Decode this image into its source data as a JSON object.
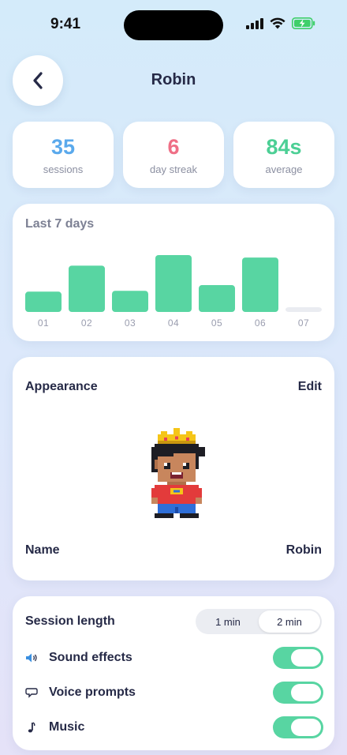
{
  "status_bar": {
    "time": "9:41"
  },
  "header": {
    "title": "Robin"
  },
  "stats": [
    {
      "value": "35",
      "label": "sessions",
      "color": "#5aa9ec"
    },
    {
      "value": "6",
      "label": "day streak",
      "color": "#ef6f86"
    },
    {
      "value": "84s",
      "label": "average",
      "color": "#4ccf95"
    }
  ],
  "chart_data": {
    "type": "bar",
    "title": "Last 7 days",
    "categories": [
      "01",
      "02",
      "03",
      "04",
      "05",
      "06",
      "07"
    ],
    "values": [
      25,
      57,
      26,
      70,
      33,
      67,
      0
    ],
    "ylim": [
      0,
      70
    ],
    "bar_color": "#58d5a2",
    "empty_color": "#eaecf1",
    "grid": false
  },
  "appearance": {
    "title": "Appearance",
    "edit_label": "Edit",
    "name_label": "Name",
    "name_value": "Robin"
  },
  "settings": {
    "session_length_label": "Session length",
    "session_options": [
      "1 min",
      "2 min"
    ],
    "selected_option": "2 min",
    "toggles": [
      {
        "label": "Sound effects",
        "icon": "speaker-icon",
        "on": true
      },
      {
        "label": "Voice prompts",
        "icon": "speech-bubble-icon",
        "on": true
      },
      {
        "label": "Music",
        "icon": "music-note-icon",
        "on": true
      }
    ]
  }
}
